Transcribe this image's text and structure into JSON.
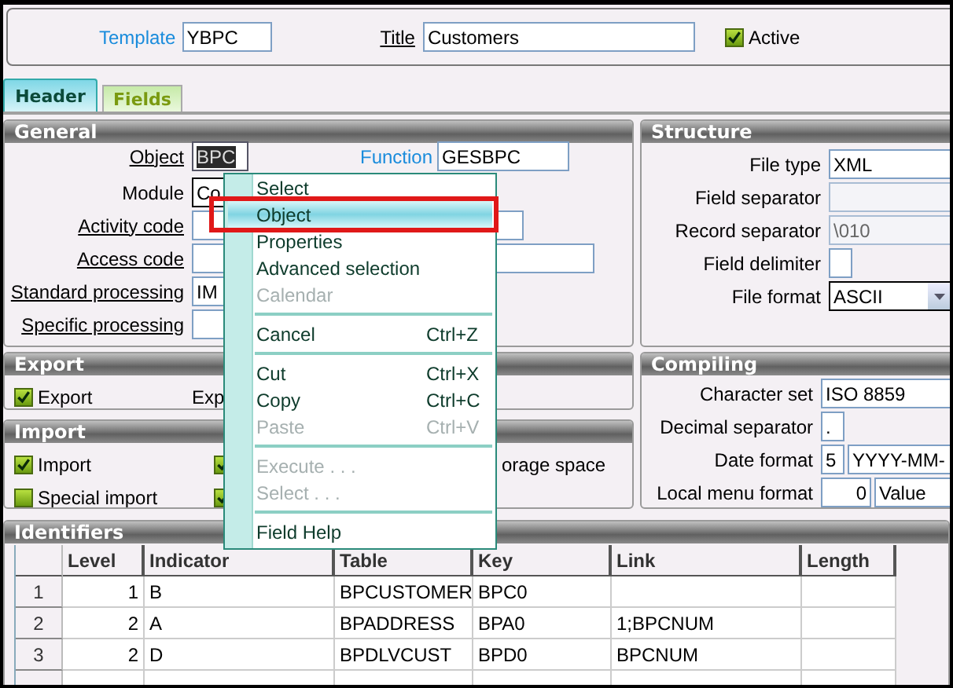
{
  "header": {
    "template_label": "Template",
    "template": "YBPC",
    "title_label": "Title",
    "title": "Customers",
    "active": {
      "label": "Active",
      "checked": true
    }
  },
  "tabs": [
    {
      "label": "Header",
      "selected": true
    },
    {
      "label": "Fields",
      "selected": false
    }
  ],
  "general": {
    "title": "General",
    "rows": [
      {
        "label": "Object",
        "kind": "mnemonic",
        "fields": [
          {
            "kind": "code",
            "value": "BPC",
            "highlighted": true
          }
        ],
        "extra": {
          "label": "Function",
          "value": "GESBPC"
        }
      },
      {
        "label": "Module",
        "kind": "plain",
        "fields": [
          {
            "kind": "combo",
            "value": "Co",
            "highlighted": false
          }
        ]
      },
      {
        "label": "Activity code",
        "kind": "mnemonic",
        "fields": [
          {
            "kind": "medium",
            "highlighted": false
          }
        ]
      },
      {
        "label": "Access code",
        "kind": "mnemonic",
        "fields": [
          {
            "kind": "long",
            "highlighted": false
          }
        ]
      },
      {
        "label": "Standard processing",
        "kind": "mnemonic",
        "fields": [
          {
            "kind": "short",
            "value": "IM",
            "highlighted": false
          }
        ]
      },
      {
        "label": "Specific processing",
        "kind": "mnemonic",
        "fields": [
          {
            "kind": "short",
            "highlighted": false
          }
        ]
      }
    ]
  },
  "structure": {
    "title": "Structure",
    "rows": [
      {
        "label": "File type",
        "fields": [
          {
            "kind": "text",
            "value": "XML",
            "disabled": false
          }
        ]
      },
      {
        "label": "Field separator",
        "fields": [
          {
            "kind": "text",
            "disabled": true
          }
        ]
      },
      {
        "label": "Record separator",
        "fields": [
          {
            "kind": "text",
            "value": "\\010",
            "disabled": true
          }
        ]
      },
      {
        "label": "Field delimiter",
        "fields": [
          {
            "kind": "char",
            "disabled": false
          }
        ]
      },
      {
        "label": "File format",
        "fields": [
          {
            "kind": "dropdown",
            "value": "ASCII",
            "disabled": false
          }
        ]
      }
    ]
  },
  "export": {
    "title": "Export",
    "items": [
      {
        "kind": "checkbox",
        "label": "Export",
        "checked": true
      },
      {
        "kind": "text",
        "label": "Exp"
      }
    ]
  },
  "compiling": {
    "title": "Compiling",
    "rows": [
      {
        "label": "Character set",
        "fields": [
          {
            "kind": "text",
            "value": "ISO 8859",
            "disabled": false
          }
        ]
      },
      {
        "label": "Decimal separator",
        "fields": [
          {
            "kind": "char",
            "value": ".",
            "disabled": false
          }
        ]
      },
      {
        "label": "Date format",
        "fields": [
          {
            "kind": "char",
            "value": "5",
            "disabled": false
          },
          {
            "kind": "text",
            "value": "YYYY-MM-",
            "disabled": false
          }
        ]
      },
      {
        "label": "Local menu format",
        "fields": [
          {
            "kind": "number",
            "value": "0",
            "disabled": false
          },
          {
            "kind": "text",
            "value": "Value",
            "disabled": false
          }
        ]
      }
    ]
  },
  "import": {
    "title": "Import",
    "rows": [
      [
        {
          "kind": "checkbox",
          "label": "Import",
          "checked": true
        },
        {
          "kind": "checkbox",
          "checked": true
        },
        {
          "kind": "text",
          "label": "orage space"
        }
      ],
      [
        {
          "kind": "checkbox",
          "label": "Special import",
          "checked": false
        },
        {
          "kind": "checkbox",
          "checked": true
        }
      ]
    ]
  },
  "identifiers": {
    "title": "Identifiers",
    "columns": [
      "Level",
      "Indicator",
      "Table",
      "Key",
      "Link",
      "Length"
    ],
    "rows": [
      {
        "number": "1",
        "cells": [
          "1",
          "B",
          "BPCUSTOMER",
          "BPC0",
          null,
          null
        ]
      },
      {
        "number": "2",
        "cells": [
          "2",
          "A",
          "BPADDRESS",
          "BPA0",
          "1;BPCNUM",
          null
        ]
      },
      {
        "number": "3",
        "cells": [
          "2",
          "D",
          "BPDLVCUST",
          "BPD0",
          "BPCNUM",
          null
        ]
      }
    ]
  },
  "context_menu": {
    "items": [
      {
        "kind": "item",
        "label": "Select",
        "disabled": false,
        "selected": false,
        "outlined": false
      },
      {
        "kind": "item",
        "label": "Object",
        "disabled": false,
        "selected": true,
        "outlined": true
      },
      {
        "kind": "item",
        "label": "Properties",
        "disabled": false,
        "selected": false,
        "outlined": false
      },
      {
        "kind": "item",
        "label": "Advanced selection",
        "disabled": false,
        "selected": false,
        "outlined": false
      },
      {
        "kind": "item",
        "label": "Calendar",
        "disabled": true,
        "selected": false,
        "outlined": false
      },
      {
        "kind": "separator"
      },
      {
        "kind": "item",
        "label": "Cancel",
        "shortcut": "Ctrl+Z",
        "disabled": false,
        "selected": false,
        "outlined": false
      },
      {
        "kind": "separator"
      },
      {
        "kind": "item",
        "label": "Cut",
        "shortcut": "Ctrl+X",
        "disabled": false,
        "selected": false,
        "outlined": false
      },
      {
        "kind": "item",
        "label": "Copy",
        "shortcut": "Ctrl+C",
        "disabled": false,
        "selected": false,
        "outlined": false
      },
      {
        "kind": "item",
        "label": "Paste",
        "shortcut": "Ctrl+V",
        "disabled": true,
        "selected": false,
        "outlined": false
      },
      {
        "kind": "separator"
      },
      {
        "kind": "item",
        "label": "Execute . . .",
        "disabled": true,
        "selected": false,
        "outlined": false
      },
      {
        "kind": "item",
        "label": "Select . . .",
        "disabled": true,
        "selected": false,
        "outlined": false
      },
      {
        "kind": "separator"
      },
      {
        "kind": "item",
        "label": "Field Help",
        "disabled": false,
        "selected": false,
        "outlined": false
      }
    ]
  }
}
